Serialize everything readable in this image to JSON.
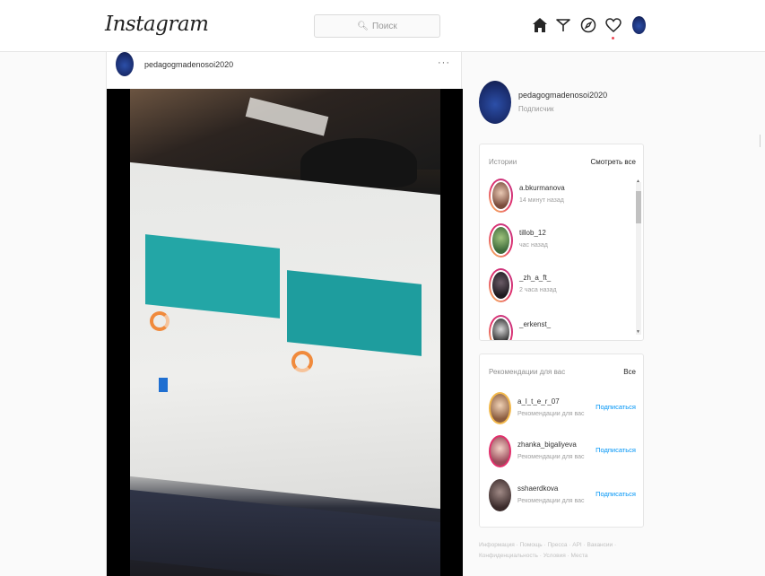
{
  "header": {
    "logo": "Instagram",
    "search_placeholder": "Поиск"
  },
  "nav_icons": [
    "home-icon",
    "direct-icon",
    "explore-icon",
    "heart-icon",
    "profile-avatar"
  ],
  "post": {
    "username": "pedagogmadenosoi2020",
    "more": "···"
  },
  "sidebar": {
    "username": "pedagogmadenosoi2020",
    "subtitle": "Подписчик"
  },
  "stories": {
    "title": "Истории",
    "action": "Смотреть все",
    "items": [
      {
        "name": "a.bkurmanova",
        "time": "14 минут назад"
      },
      {
        "name": "tillob_12",
        "time": "час назад"
      },
      {
        "name": "_zh_a_ft_",
        "time": "2 часа назад"
      },
      {
        "name": "_erkenst_",
        "time": ""
      }
    ]
  },
  "suggestions": {
    "title": "Рекомендации для вас",
    "action": "Все",
    "items": [
      {
        "name": "a_l_t_e_r_07",
        "desc": "Рекомендации для вас",
        "follow": "Подписаться"
      },
      {
        "name": "zhanka_bigaliyeva",
        "desc": "Рекомендации для вас",
        "follow": "Подписаться"
      },
      {
        "name": "sshaerdkova",
        "desc": "Рекомендации для вас",
        "follow": "Подписаться"
      }
    ]
  },
  "footer": "Информация · Помощь · Пресса · API · Вакансии · Конфиденциальность · Условия · Места",
  "colors": {
    "accent_blue": "#0095f6",
    "notification_red": "#ed4956",
    "teal_panel": "#23a6a6"
  }
}
